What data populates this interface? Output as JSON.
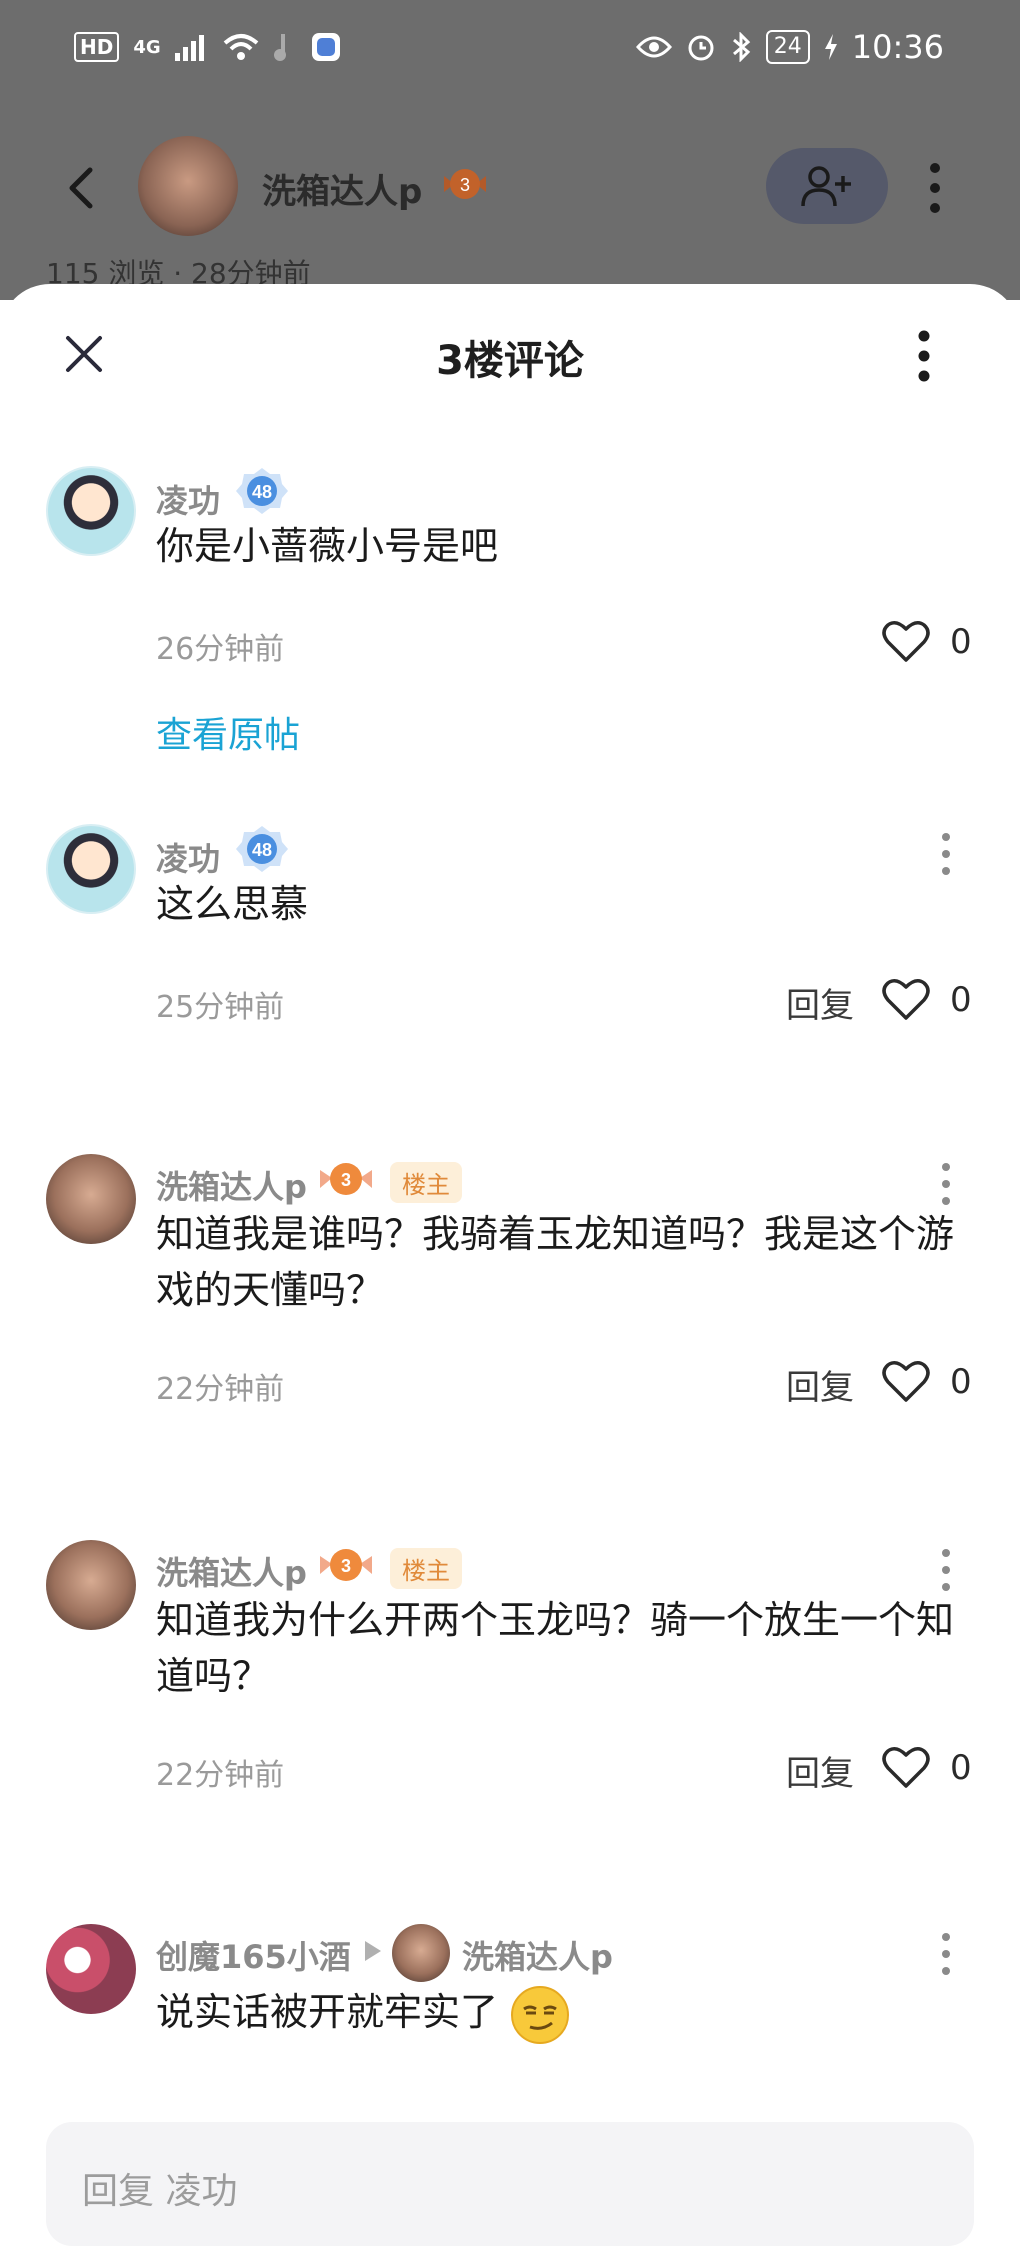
{
  "status_bar": {
    "hd": "HD",
    "network": "4G",
    "battery": "24",
    "time": "10:36"
  },
  "post_header": {
    "author_name": "洗箱达人p",
    "author_level": "3",
    "views_text": "115 浏览 · 28分钟前"
  },
  "sheet": {
    "title": "3楼评论"
  },
  "comments": [
    {
      "user": "凌功",
      "level": "48",
      "text": "你是小蔷薇小号是吧",
      "time": "26分钟前",
      "likes": "0",
      "link": "查看原帖"
    },
    {
      "user": "凌功",
      "level": "48",
      "text": "这么思慕",
      "time": "25分钟前",
      "reply": "回复",
      "likes": "0"
    },
    {
      "user": "洗箱达人p",
      "level": "3",
      "tag": "楼主",
      "text": "知道我是谁吗？我骑着玉龙知道吗？我是这个游戏的天懂吗？",
      "time": "22分钟前",
      "reply": "回复",
      "likes": "0"
    },
    {
      "user": "洗箱达人p",
      "level": "3",
      "tag": "楼主",
      "text": "知道我为什么开两个玉龙吗？骑一个放生一个知道吗？",
      "time": "22分钟前",
      "reply": "回复",
      "likes": "0"
    },
    {
      "user": "创魔165小酒",
      "reply_to": "洗箱达人p",
      "text": "说实话被开就牢实了"
    }
  ],
  "reply_input": {
    "placeholder": "回复 凌功"
  },
  "colors": {
    "link": "#1aa3d4",
    "owner_tag_text": "#e08a3a",
    "owner_tag_bg": "#fdefd9",
    "level_badge_blue": "#4a8fe0",
    "level_badge_orange": "#ef8a3c"
  },
  "icons": [
    "back-icon",
    "add-friend-icon",
    "more-vertical-icon",
    "close-icon",
    "heart-icon",
    "reply-arrow-icon",
    "smirk-emoji-icon"
  ]
}
